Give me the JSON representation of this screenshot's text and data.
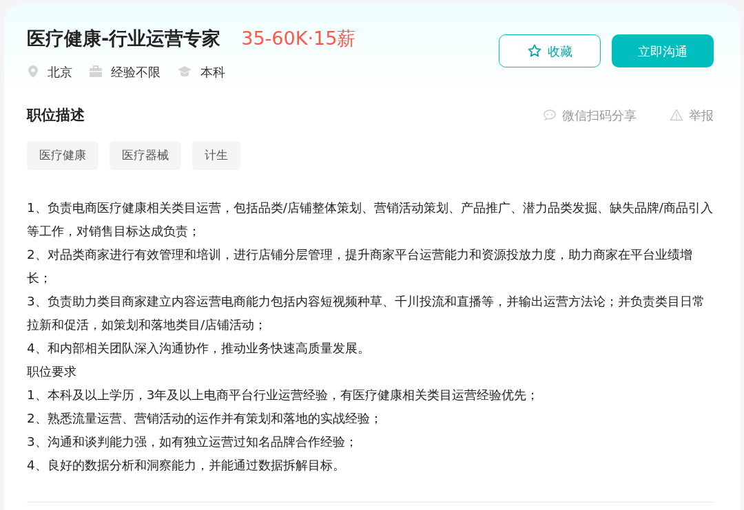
{
  "job": {
    "title": "医疗健康-行业运营专家",
    "salary": "35-60K·15薪",
    "meta": [
      {
        "kind": "location",
        "text": "北京"
      },
      {
        "kind": "experience",
        "text": "经验不限"
      },
      {
        "kind": "education",
        "text": "本科"
      }
    ],
    "buttons": [
      {
        "kind": "outline",
        "label": "收藏"
      },
      {
        "kind": "primary",
        "label": "立即沟通"
      }
    ]
  },
  "description": {
    "heading": "职位描述",
    "actions": [
      {
        "kind": "share",
        "label": "微信扫码分享"
      },
      {
        "kind": "report",
        "label": "举报"
      }
    ],
    "tags": [
      "医疗健康",
      "医疗器械",
      "计生"
    ],
    "lines": [
      "1、负责电商医疗健康相关类目运营，包括品类/店铺整体策划、营销活动策划、产品推广、潜力品类发掘、缺失品牌/商品引入等工作，对销售目标达成负责；",
      "2、对品类商家进行有效管理和培训，进行店铺分层管理，提升商家平台运营能力和资源投放力度，助力商家在平台业绩增长；",
      "3、负责助力类目商家建立内容运营电商能力包括内容短视频种草、千川投流和直播等，并输出运营方法论；并负责类目日常拉新和促活，如策划和落地类目/店铺活动；",
      "4、和内部相关团队深入沟通协作，推动业务快速高质量发展。",
      "职位要求",
      "1、本科及以上学历，3年及以上电商平台行业运营经验，有医疗健康相关类目运营经验优先；",
      "2、熟悉流量运营、营销活动的运作并有策划和落地的实战经验；",
      "3、沟通和谈判能力强，如有独立运营过知名品牌合作经验；",
      "4、良好的数据分析和洞察能力，并能通过数据拆解目标。"
    ]
  }
}
